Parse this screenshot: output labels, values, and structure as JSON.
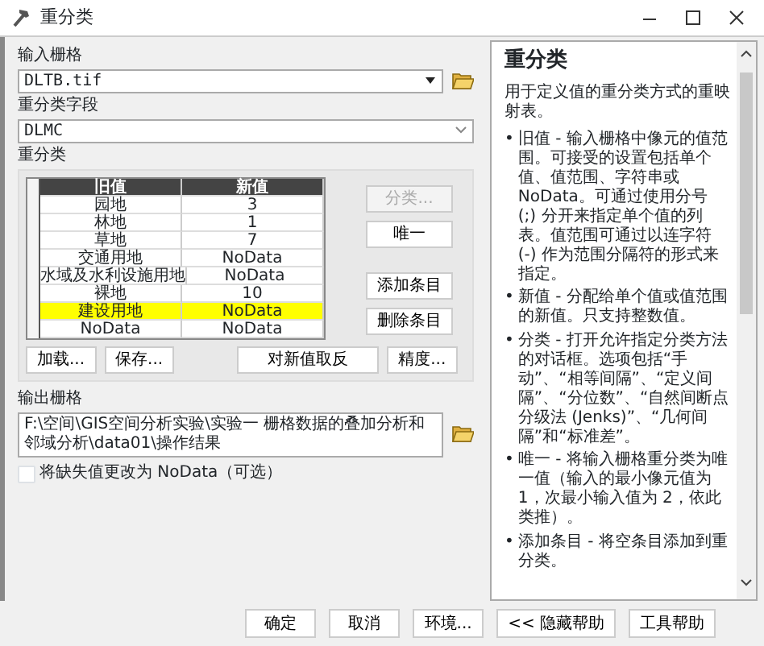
{
  "window": {
    "title": "重分类"
  },
  "input_raster": {
    "label": "输入栅格",
    "value": "DLTB.tif"
  },
  "reclass_field": {
    "label": "重分类字段",
    "value": "DLMC"
  },
  "reclassification": {
    "label": "重分类",
    "columns": [
      "旧值",
      "新值"
    ],
    "rows": [
      {
        "old": "园地",
        "new": "3",
        "selected": false
      },
      {
        "old": "林地",
        "new": "1",
        "selected": false
      },
      {
        "old": "草地",
        "new": "7",
        "selected": false
      },
      {
        "old": "交通用地",
        "new": "NoData",
        "selected": false
      },
      {
        "old": "水域及水利设施用地",
        "new": "NoData",
        "selected": false
      },
      {
        "old": "裸地",
        "new": "10",
        "selected": false
      },
      {
        "old": "建设用地",
        "new": "NoData",
        "selected": true
      },
      {
        "old": "NoData",
        "new": "NoData",
        "selected": false
      }
    ],
    "side_buttons": [
      {
        "label": "分类...",
        "disabled": true
      },
      {
        "label": "唯一",
        "disabled": false
      },
      {
        "label": "添加条目",
        "disabled": false
      },
      {
        "label": "删除条目",
        "disabled": false
      }
    ],
    "bottom_buttons": [
      "加载...",
      "保存...",
      "对新值取反",
      "精度..."
    ]
  },
  "output_raster": {
    "label": "输出栅格",
    "value": "F:\\空间\\GIS空间分析实验\\实验一 栅格数据的叠加分析和邻域分析\\data01\\操作结果"
  },
  "nodata_option": {
    "label": "将缺失值更改为 NoData（可选）",
    "checked": false
  },
  "footer_buttons": [
    "确定",
    "取消",
    "环境...",
    "<< 隐藏帮助",
    "工具帮助"
  ],
  "help": {
    "title": "重分类",
    "intro": "用于定义值的重分类方式的重映射表。",
    "items": [
      {
        "bullet": "•",
        "text": "旧值 - 输入栅格中像元的值范围。可接受的设置包括单个值、值范围、字符串或 NoData。可通过使用分号 (;) 分开来指定单个值的列表。值范围可通过以连字符 (-) 作为范围分隔符的形式来指定。"
      },
      {
        "bullet": "•",
        "text": "新值 - 分配给单个值或值范围的新值。只支持整数值。"
      },
      {
        "bullet": "•",
        "text": "分类 - 打开允许指定分类方法的对话框。选项包括“手动”、“相等间隔”、“定义间隔”、“分位数”、“自然间断点分级法 (Jenks)”、“几何间隔”和“标准差”。"
      },
      {
        "bullet": "•",
        "text": "唯一 - 将输入栅格重分类为唯一值（输入的最小像元值为 1，次最小输入值为 2，依此类推）。"
      },
      {
        "bullet": "•",
        "text": "添加条目 - 将空条目添加到重分类。"
      }
    ]
  }
}
